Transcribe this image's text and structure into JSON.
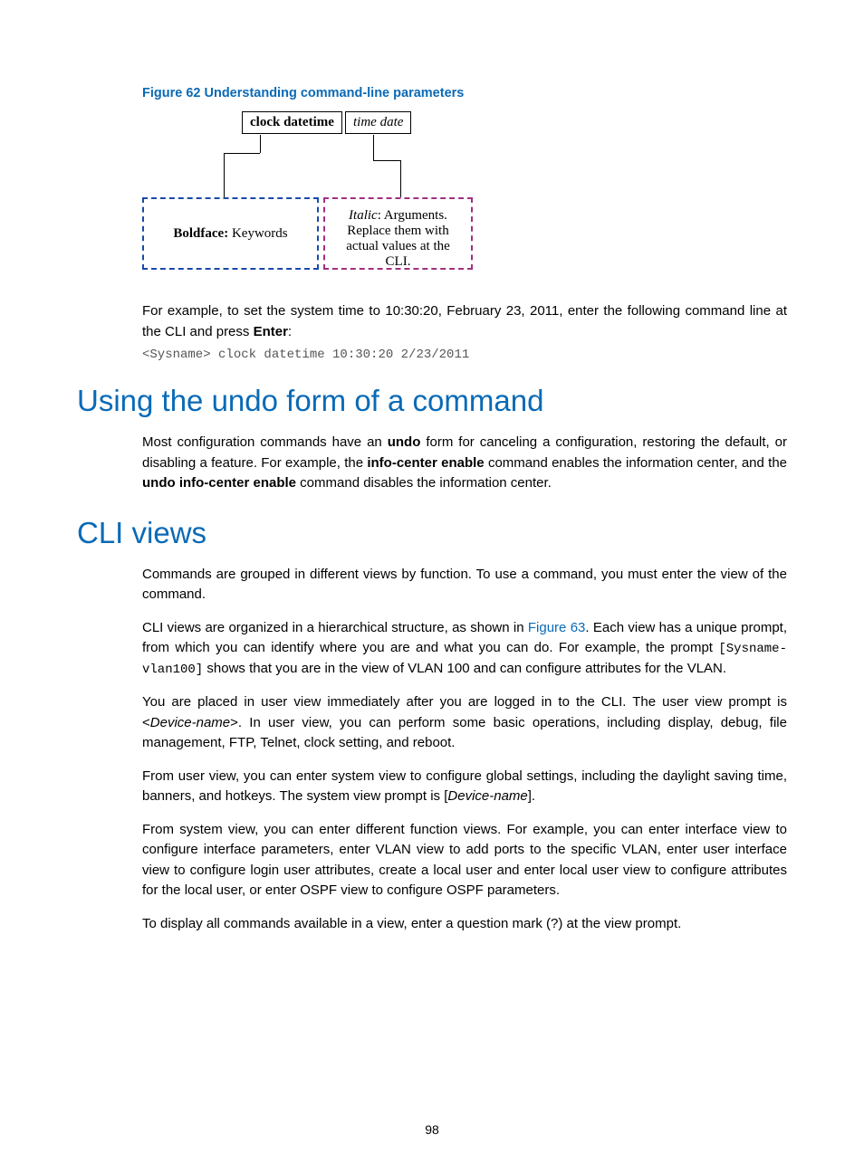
{
  "figure": {
    "caption": "Figure 62 Understanding command-line parameters",
    "cmd_keyword": "clock datetime",
    "cmd_arg": "time date",
    "box_keywords_bold": "Boldface:",
    "box_keywords_rest": " Keywords",
    "box_args_italic": "Italic",
    "box_args_rest": ": Arguments. Replace them with actual values at the CLI."
  },
  "example": {
    "intro_a": "For example, to set the system time to 10:30:20, February 23, 2011, enter the following command line at the CLI and press ",
    "intro_bold": "Enter",
    "intro_b": ":",
    "code": "<Sysname> clock datetime 10:30:20 2/23/2011"
  },
  "h1_undo": "Using the undo form of a command",
  "undo_para": {
    "a": "Most configuration commands have an ",
    "b1": "undo",
    "c": " form for canceling a configuration, restoring the default, or disabling a feature. For example, the ",
    "b2": "info-center enable",
    "d": " command enables the information center, and the ",
    "b3": "undo info-center enable",
    "e": " command disables the information center."
  },
  "h1_views": "CLI views",
  "views": {
    "p1": "Commands are grouped in different views by function. To use a command, you must enter the view of the command.",
    "p2a": "CLI views are organized in a hierarchical structure, as shown in ",
    "p2link": "Figure 63",
    "p2b": ". Each view has a unique prompt, from which you can identify where you are and what you can do. For example, the prompt ",
    "p2code": "[Sysname-vlan100]",
    "p2c": " shows that you are in the view of VLAN 100 and can configure attributes for the VLAN.",
    "p3a": "You are placed in user view immediately after you are logged in to the CLI. The user view prompt is <",
    "p3i": "Device-name",
    "p3b": ">. In user view, you can perform some basic operations, including display, debug, file management, FTP, Telnet, clock setting, and reboot.",
    "p4a": "From user view, you can enter system view to configure global settings, including the daylight saving time, banners, and hotkeys. The system view prompt is [",
    "p4i": "Device-name",
    "p4b": "].",
    "p5": "From system view, you can enter different function views. For example, you can enter interface view to configure interface parameters, enter VLAN view to add ports to the specific VLAN, enter user interface view to configure login user attributes, create a local user and enter local user view to configure attributes for the local user, or enter OSPF view to configure OSPF parameters.",
    "p6": "To display all commands available in a view, enter a question mark (?) at the view prompt."
  },
  "page_number": "98"
}
